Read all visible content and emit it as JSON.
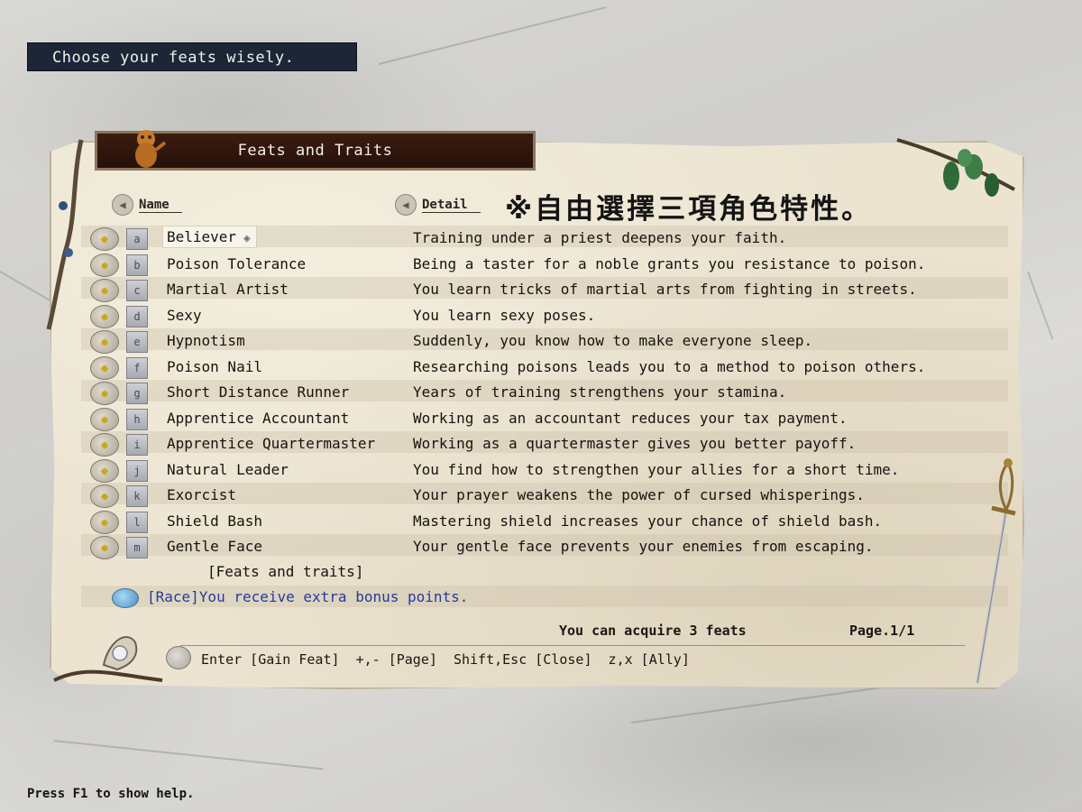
{
  "banner": {
    "text": "Choose your feats wisely."
  },
  "panel": {
    "title": "Feats and Traits"
  },
  "columns": {
    "name": "Name",
    "detail": "Detail"
  },
  "annotation": "※自由選擇三項角色特性。",
  "feats": [
    {
      "icon_label": "a",
      "name": "Believer",
      "desc": "Training under a priest deepens your faith."
    },
    {
      "icon_label": "b",
      "name": "Poison Tolerance",
      "desc": "Being a taster for a noble grants you resistance to poison."
    },
    {
      "icon_label": "c",
      "name": "Martial Artist",
      "desc": "You learn tricks of martial arts from fighting in streets."
    },
    {
      "icon_label": "d",
      "name": "Sexy",
      "desc": "You learn sexy poses."
    },
    {
      "icon_label": "e",
      "name": "Hypnotism",
      "desc": "Suddenly, you know how to make everyone sleep."
    },
    {
      "icon_label": "f",
      "name": "Poison Nail",
      "desc": "Researching poisons leads you to a method to poison others."
    },
    {
      "icon_label": "g",
      "name": "Short Distance Runner",
      "desc": "Years of training strengthens your stamina."
    },
    {
      "icon_label": "h",
      "name": "Apprentice Accountant",
      "desc": "Working as an accountant reduces your tax payment."
    },
    {
      "icon_label": "i",
      "name": "Apprentice Quartermaster",
      "desc": "Working as a quartermaster gives you better payoff."
    },
    {
      "icon_label": "j",
      "name": "Natural Leader",
      "desc": "You find how to strengthen your allies for a short time."
    },
    {
      "icon_label": "k",
      "name": "Exorcist",
      "desc": "Your prayer weakens the power of cursed whisperings."
    },
    {
      "icon_label": "l",
      "name": "Shield Bash",
      "desc": "Mastering shield increases your chance of shield bash."
    },
    {
      "icon_label": "m",
      "name": "Gentle Face",
      "desc": "Your gentle face prevents your enemies from escaping."
    }
  ],
  "footer_label": "[Feats and traits]",
  "race_note": "[Race]You receive extra bonus points.",
  "acquire": "You can acquire 3 feats",
  "page": "Page.1/1",
  "keys": "Enter [Gain Feat]  +,- [Page]  Shift,Esc [Close]  z,x [Ally]",
  "help": "Press F1 to show help."
}
